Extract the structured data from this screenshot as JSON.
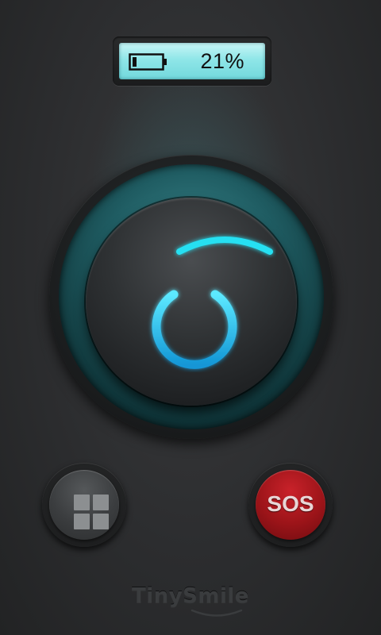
{
  "battery": {
    "level_text": "21%",
    "level_fraction": 0.21,
    "icon": "battery-icon"
  },
  "power_button": {
    "icon": "power-icon",
    "glow_color": "#1fd8ec"
  },
  "menu_button": {
    "icon": "grid-icon"
  },
  "sos_button": {
    "label": "SOS",
    "color": "#b31a21"
  },
  "brand": {
    "name": "TinySmile"
  }
}
